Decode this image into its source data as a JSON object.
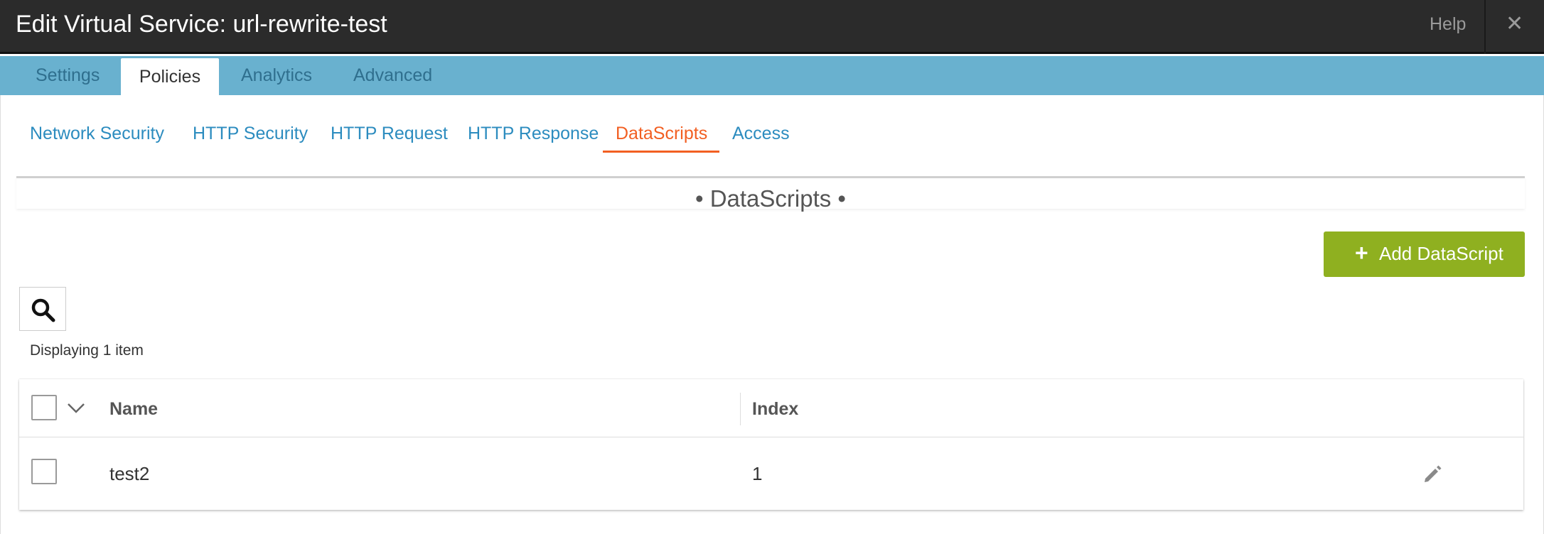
{
  "window": {
    "title": "Edit Virtual Service: url-rewrite-test",
    "help_label": "Help",
    "close_icon": "close-icon"
  },
  "tabs": [
    {
      "label": "Settings",
      "active": false
    },
    {
      "label": "Policies",
      "active": true
    },
    {
      "label": "Analytics",
      "active": false
    },
    {
      "label": "Advanced",
      "active": false
    }
  ],
  "subtabs": [
    {
      "label": "Network Security",
      "active": false
    },
    {
      "label": "HTTP Security",
      "active": false
    },
    {
      "label": "HTTP Request",
      "active": false
    },
    {
      "label": "HTTP Response",
      "active": false
    },
    {
      "label": "DataScripts",
      "active": true
    },
    {
      "label": "Access",
      "active": false
    }
  ],
  "section": {
    "title": "• DataScripts •"
  },
  "toolbar": {
    "add_label": "Add DataScript",
    "add_icon": "plus-icon",
    "search_icon": "search-icon",
    "count_text": "Displaying 1 item"
  },
  "grid": {
    "columns": [
      "Name",
      "Index"
    ],
    "rows": [
      {
        "name": "test2",
        "index": "1"
      }
    ]
  },
  "colors": {
    "titlebar": "#2b2b2b",
    "tabbar": "#69b1cf",
    "link": "#2c8cbf",
    "active_subtab": "#f25f22",
    "add_button": "#8fb020"
  }
}
